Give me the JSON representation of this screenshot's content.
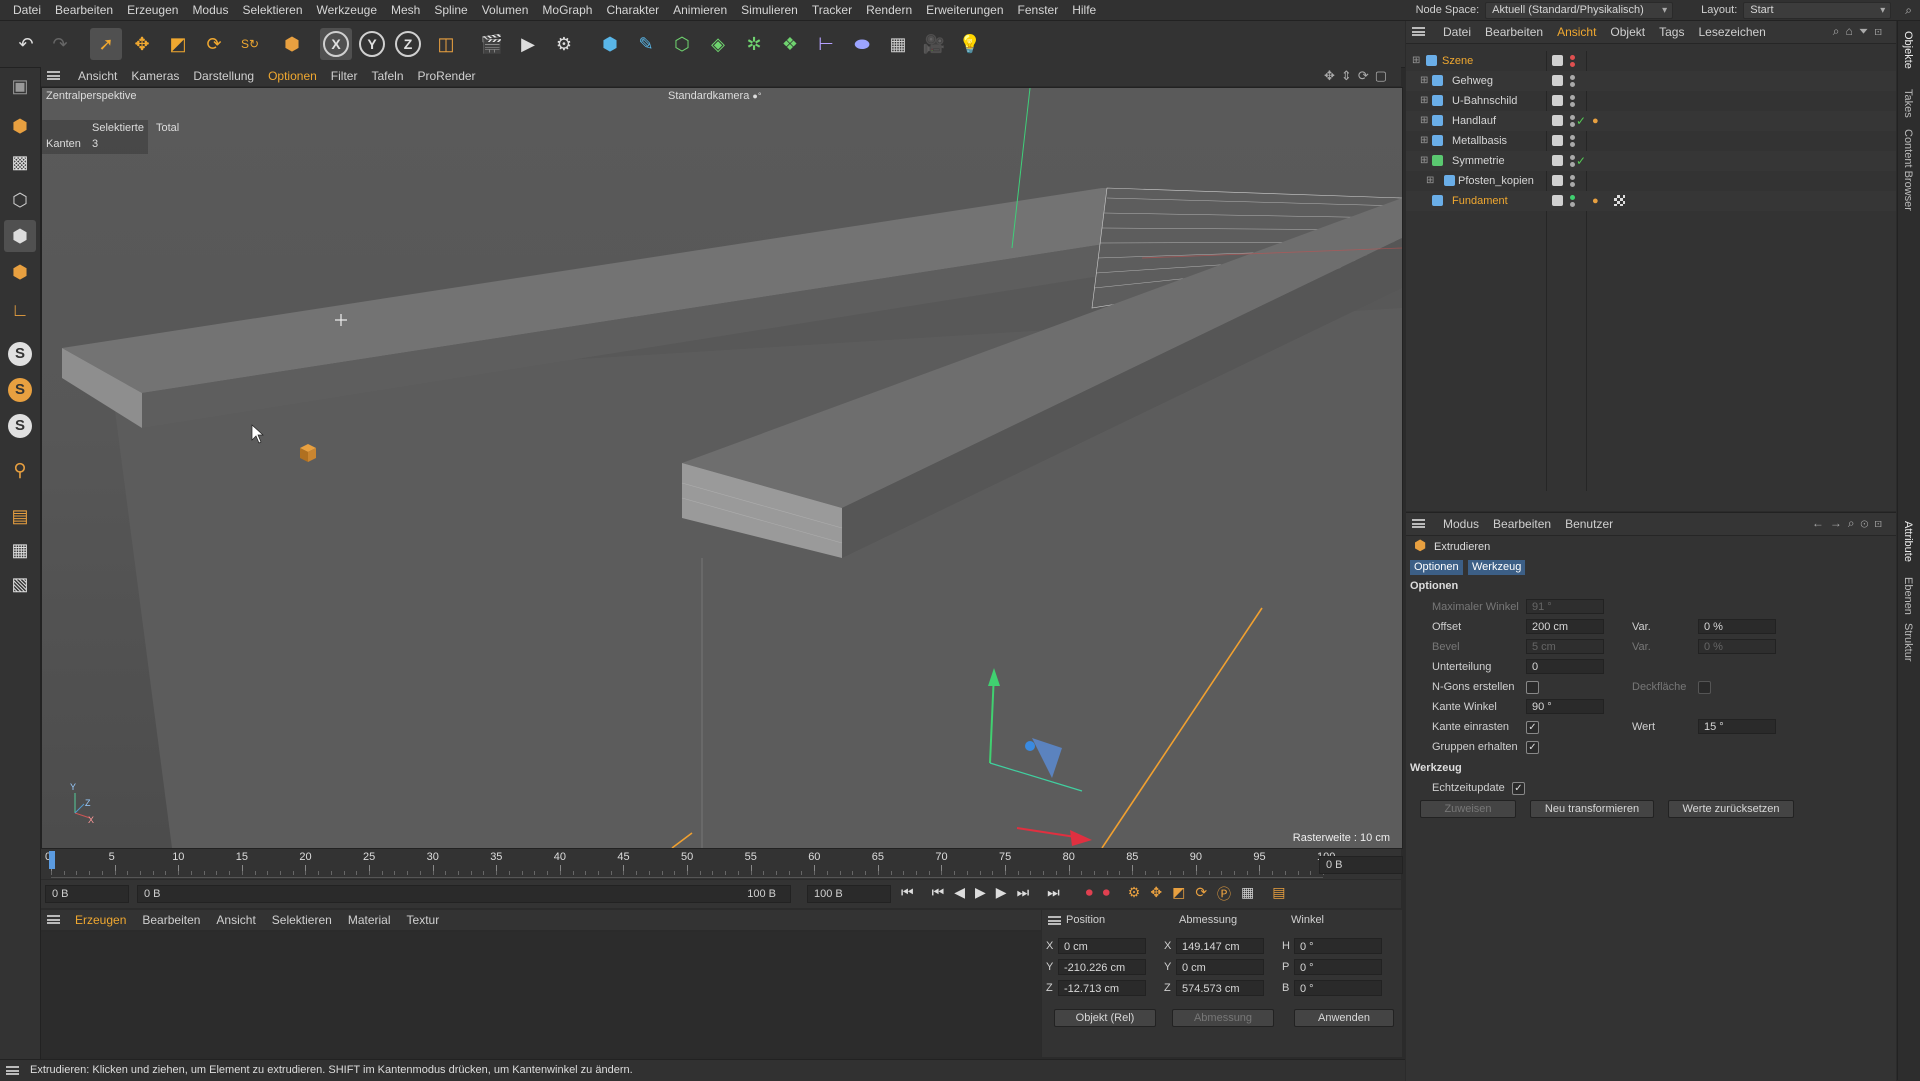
{
  "menubar": {
    "items": [
      "Datei",
      "Bearbeiten",
      "Erzeugen",
      "Modus",
      "Selektieren",
      "Werkzeuge",
      "Mesh",
      "Spline",
      "Volumen",
      "MoGraph",
      "Charakter",
      "Animieren",
      "Simulieren",
      "Tracker",
      "Rendern",
      "Erweiterungen",
      "Fenster",
      "Hilfe"
    ],
    "node_space_label": "Node Space:",
    "node_space_value": "Aktuell (Standard/Physikalisch)",
    "layout_label": "Layout:",
    "layout_value": "Start"
  },
  "toolbar": {
    "axis_x": "X",
    "axis_y": "Y",
    "axis_z": "Z"
  },
  "viewport": {
    "menu": [
      "Ansicht",
      "Kameras",
      "Darstellung",
      "Optionen",
      "Filter",
      "Tafeln",
      "ProRender"
    ],
    "active_menu": "Optionen",
    "view_name": "Zentralperspektive",
    "camera": "Standardkamera",
    "stats_header_selected": "Selektierte",
    "stats_header_total": "Total",
    "stats_row_label": "Kanten",
    "stats_row_value": "3",
    "grid_info": "Rasterweite : 10 cm"
  },
  "timeline": {
    "ticks": [
      "0",
      "5",
      "10",
      "15",
      "20",
      "25",
      "30",
      "35",
      "40",
      "45",
      "50",
      "55",
      "60",
      "65",
      "70",
      "75",
      "80",
      "85",
      "90",
      "95",
      "100"
    ],
    "current_frame": "0 B",
    "start_field": "0 B",
    "range_start": "0 B",
    "range_end": "100 B",
    "end_field": "100 B"
  },
  "material_manager": {
    "menu": [
      "Erzeugen",
      "Bearbeiten",
      "Ansicht",
      "Selektieren",
      "Material",
      "Textur"
    ]
  },
  "coordinates": {
    "headers": {
      "position": "Position",
      "size": "Abmessung",
      "rotation": "Winkel"
    },
    "rows": [
      {
        "pl": "X",
        "pv": "0 cm",
        "sl": "X",
        "sv": "149.147 cm",
        "rl": "H",
        "rv": "0 °"
      },
      {
        "pl": "Y",
        "pv": "-210.226 cm",
        "sl": "Y",
        "sv": "0 cm",
        "rl": "P",
        "rv": "0 °"
      },
      {
        "pl": "Z",
        "pv": "-12.713 cm",
        "sl": "Z",
        "sv": "574.573 cm",
        "rl": "B",
        "rv": "0 °"
      }
    ],
    "mode": "Objekt (Rel)",
    "size_mode": "Abmessung",
    "apply": "Anwenden"
  },
  "status": "Extrudieren: Klicken und ziehen, um Element zu extrudieren. SHIFT im Kantenmodus drücken, um Kantenwinkel zu ändern.",
  "object_manager": {
    "menu": [
      "Datei",
      "Bearbeiten",
      "Ansicht",
      "Objekt",
      "Tags",
      "Lesezeichen"
    ],
    "active_menu": "Ansicht",
    "objects": [
      {
        "name": "Szene",
        "color": "#f0a830"
      },
      {
        "name": "Gehweg",
        "color": "#d6d6d6"
      },
      {
        "name": "U-Bahnschild",
        "color": "#d6d6d6"
      },
      {
        "name": "Handlauf",
        "color": "#d6d6d6"
      },
      {
        "name": "Metallbasis",
        "color": "#d6d6d6"
      },
      {
        "name": "Symmetrie",
        "color": "#d6d6d6"
      },
      {
        "name": "Pfosten_kopien",
        "color": "#d6d6d6"
      },
      {
        "name": "Fundament",
        "color": "#f0a830"
      }
    ]
  },
  "attributes": {
    "menu": [
      "Modus",
      "Bearbeiten",
      "Benutzer"
    ],
    "tool_name": "Extrudieren",
    "tabs": [
      "Optionen",
      "Werkzeug"
    ],
    "section_options": "Optionen",
    "max_angle_label": "Maximaler Winkel",
    "max_angle_value": "91 °",
    "offset_label": "Offset",
    "offset_value": "200 cm",
    "var1_label": "Var.",
    "var1_value": "0 %",
    "bevel_label": "Bevel",
    "bevel_value": "5 cm",
    "var2_label": "Var.",
    "var2_value": "0 %",
    "subdiv_label": "Unterteilung",
    "subdiv_value": "0",
    "ngons_label": "N-Gons erstellen",
    "cap_label": "Deckfläche",
    "edge_angle_label": "Kante Winkel",
    "edge_angle_value": "90 °",
    "edge_snap_label": "Kante einrasten",
    "value_label": "Wert",
    "value_value": "15 °",
    "keep_groups_label": "Gruppen erhalten",
    "section_tool": "Werkzeug",
    "realtime_label": "Echtzeitupdate",
    "btn_assign": "Zuweisen",
    "btn_new_transform": "Neu transformieren",
    "btn_reset": "Werte zurücksetzen"
  },
  "side_tabs": [
    "Objekte",
    "Takes",
    "Content Browser",
    "Attribute",
    "Ebenen",
    "Struktur"
  ]
}
